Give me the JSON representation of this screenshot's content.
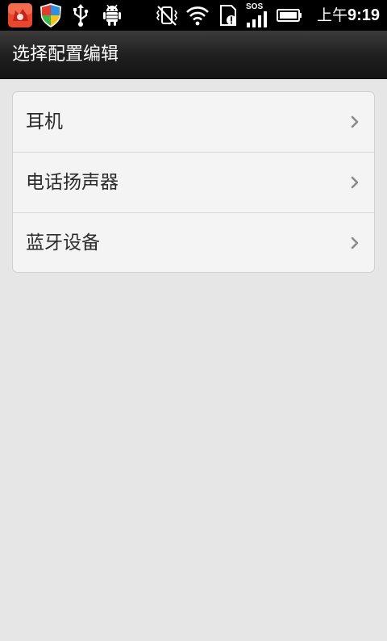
{
  "status_bar": {
    "clock_prefix": "上午",
    "clock_time": "9:19",
    "icons": [
      "app-fox-icon",
      "shield-icon",
      "usb-icon",
      "android-debug-icon",
      "vibrate-off-icon",
      "wifi-icon",
      "sd-card-icon",
      "sos-signal-icon",
      "battery-icon"
    ],
    "sos_label": "SOS"
  },
  "action_bar": {
    "title": "选择配置编辑"
  },
  "list": {
    "items": [
      {
        "label": "耳机"
      },
      {
        "label": "电话扬声器"
      },
      {
        "label": "蓝牙设备"
      }
    ]
  },
  "colors": {
    "background": "#e6e6e6",
    "card": "#f4f4f4",
    "action_bar": "#1e1e1e"
  }
}
